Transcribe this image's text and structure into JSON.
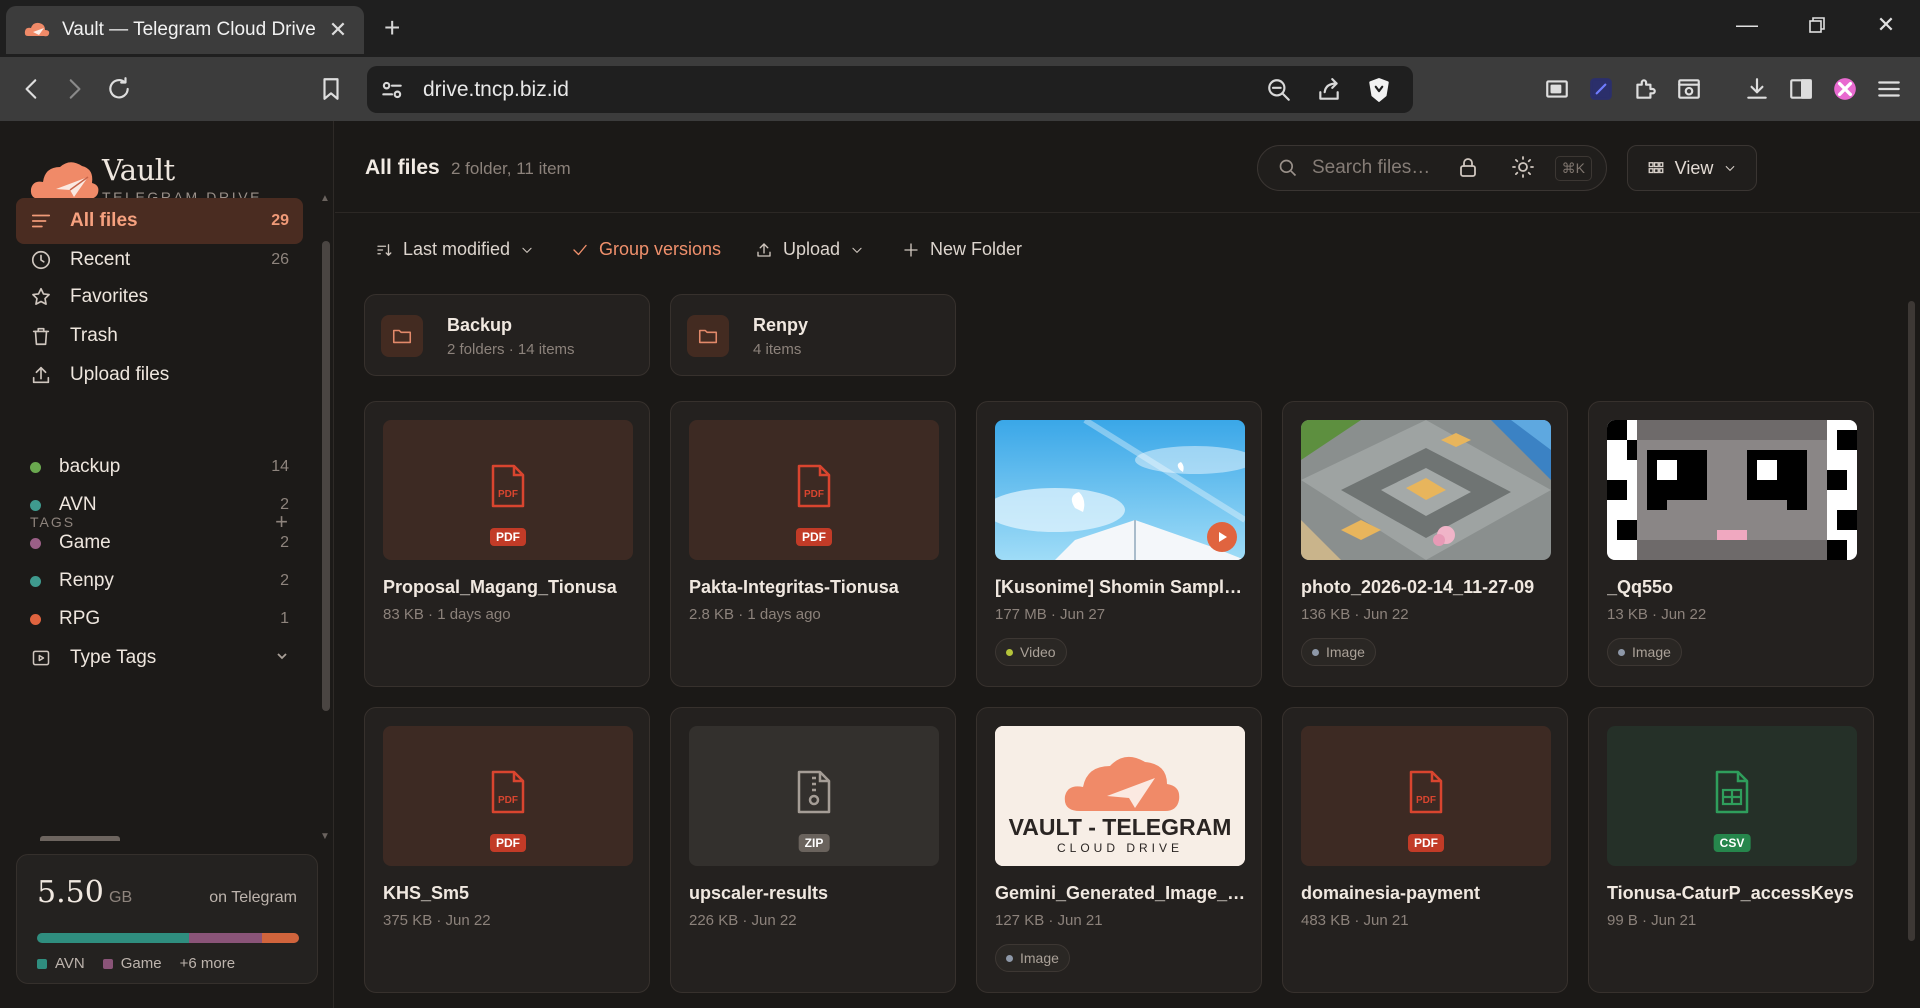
{
  "browser": {
    "tab_title": "Vault — Telegram Cloud Drive",
    "url": "drive.tncp.biz.id"
  },
  "brand": {
    "title": "Vault",
    "subtitle": "TELEGRAM DRIVE",
    "accent": "#f08a68"
  },
  "nav": [
    {
      "label": "All files",
      "count": "29",
      "icon": "menu-lines-icon",
      "active": true
    },
    {
      "label": "Recent",
      "count": "26",
      "icon": "clock-icon"
    },
    {
      "label": "Favorites",
      "count": "",
      "icon": "star-icon"
    },
    {
      "label": "Trash",
      "count": "",
      "icon": "trash-icon"
    },
    {
      "label": "Upload files",
      "count": "",
      "icon": "upload-icon"
    }
  ],
  "tags": {
    "title": "TAGS",
    "add": "+",
    "items": [
      {
        "label": "backup",
        "count": "14",
        "color": "#6aa84f"
      },
      {
        "label": "AVN",
        "count": "2",
        "color": "#3f9a8e"
      },
      {
        "label": "Game",
        "count": "2",
        "color": "#9a5f86"
      },
      {
        "label": "Renpy",
        "count": "2",
        "color": "#3f9a8e"
      },
      {
        "label": "RPG",
        "count": "1",
        "color": "#e0643f"
      }
    ],
    "type_tags_label": "Type Tags"
  },
  "storage": {
    "value": "5.50",
    "unit": "GB",
    "where": "on Telegram",
    "segments": [
      {
        "fraction": 0.58,
        "color": "#2f8e7f"
      },
      {
        "fraction": 0.28,
        "color": "#8a5478"
      },
      {
        "fraction": 0.14,
        "color": "#d0643c"
      }
    ],
    "legend": [
      {
        "label": "AVN",
        "color": "#2f8e7f"
      },
      {
        "label": "Game",
        "color": "#8a5478"
      }
    ],
    "more": "+6 more"
  },
  "header": {
    "title": "All files",
    "subtitle": "2 folder, 11 item",
    "search_placeholder": "Search files…",
    "search_shortcut": "⌘K",
    "view_label": "View"
  },
  "actions": {
    "sort": "Last modified",
    "group": "Group versions",
    "upload": "Upload",
    "new_folder": "New Folder"
  },
  "folders": [
    {
      "name": "Backup",
      "meta": "2 folders · 14 items"
    },
    {
      "name": "Renpy",
      "meta": "4 items"
    }
  ],
  "files": [
    {
      "name": "Proposal_Magang_Tionusa",
      "meta": "83 KB · 1 days ago",
      "type": "pdf",
      "badge": "PDF",
      "chip": ""
    },
    {
      "name": "Pakta-Integritas-Tionusa",
      "meta": "2.8 KB · 1 days ago",
      "type": "pdf",
      "badge": "PDF",
      "chip": ""
    },
    {
      "name": "[Kusonime] Shomin Sample B...",
      "meta": "177 MB · Jun 27",
      "type": "video",
      "badge": "",
      "chip": "Video"
    },
    {
      "name": "photo_2026-02-14_11-27-09",
      "meta": "136 KB · Jun 22",
      "type": "map",
      "badge": "",
      "chip": "Image"
    },
    {
      "name": "_Qq55o",
      "meta": "13 KB · Jun 22",
      "type": "pixel",
      "badge": "",
      "chip": "Image"
    },
    {
      "name": "KHS_Sm5",
      "meta": "375 KB · Jun 22",
      "type": "pdf",
      "badge": "PDF",
      "chip": ""
    },
    {
      "name": "upscaler-results",
      "meta": "226 KB · Jun 22",
      "type": "zip",
      "badge": "ZIP",
      "chip": ""
    },
    {
      "name": "Gemini_Generated_Image_id...",
      "meta": "127 KB · Jun 21",
      "type": "logo",
      "badge": "",
      "chip": "Image",
      "logo_line1": "VAULT - TELEGRAM",
      "logo_line2": "CLOUD DRIVE"
    },
    {
      "name": "domainesia-payment",
      "meta": "483 KB · Jun 21",
      "type": "pdf",
      "badge": "PDF",
      "chip": ""
    },
    {
      "name": "Tionusa-CaturP_accessKeys",
      "meta": "99 B · Jun 21",
      "type": "csv",
      "badge": "CSV",
      "chip": ""
    }
  ]
}
